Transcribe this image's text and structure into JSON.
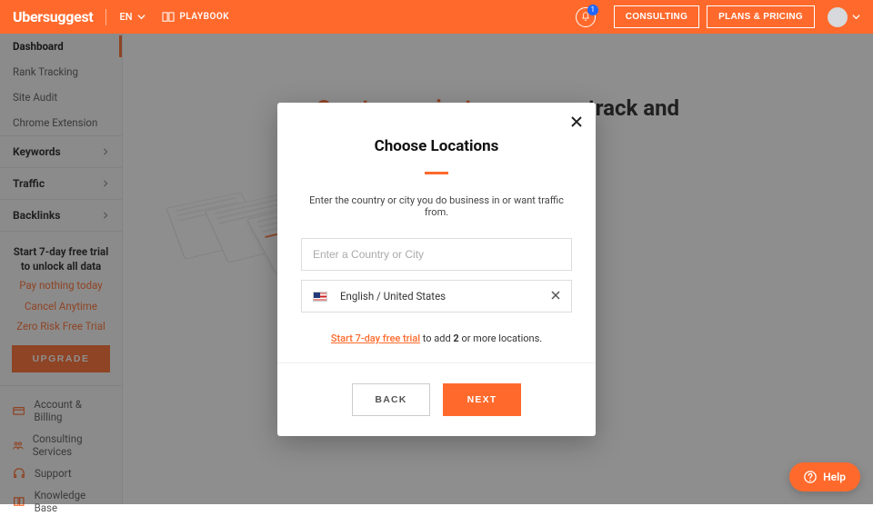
{
  "brand": "Ubersuggest",
  "lang": "EN",
  "playbook": "PLAYBOOK",
  "notif_count": "1",
  "top_buttons": {
    "consulting": "CONSULTING",
    "plans": "PLANS & PRICING"
  },
  "sidebar": {
    "items": [
      "Dashboard",
      "Rank Tracking",
      "Site Audit",
      "Chrome Extension"
    ],
    "sections": [
      "Keywords",
      "Traffic",
      "Backlinks"
    ],
    "trial": {
      "line1": "Start 7-day free trial",
      "line2": "to unlock all data",
      "o1": "Pay nothing today",
      "o2": "Cancel Anytime",
      "o3": "Zero Risk Free Trial"
    },
    "upgrade": "UPGRADE",
    "bottom": [
      "Account & Billing",
      "Consulting Services",
      "Support",
      "Knowledge Base"
    ]
  },
  "main_heading": {
    "hl": "Create a project",
    "rest": " so you can track and"
  },
  "modal": {
    "title": "Choose Locations",
    "subtitle": "Enter the country or city you do business in or want traffic from.",
    "placeholder": "Enter a Country or City",
    "selected": "English / United States",
    "upsell_link": "Start 7-day free trial",
    "upsell_mid": " to add ",
    "upsell_num": "2",
    "upsell_end": " or more locations.",
    "back": "BACK",
    "next": "NEXT"
  },
  "help": "Help"
}
